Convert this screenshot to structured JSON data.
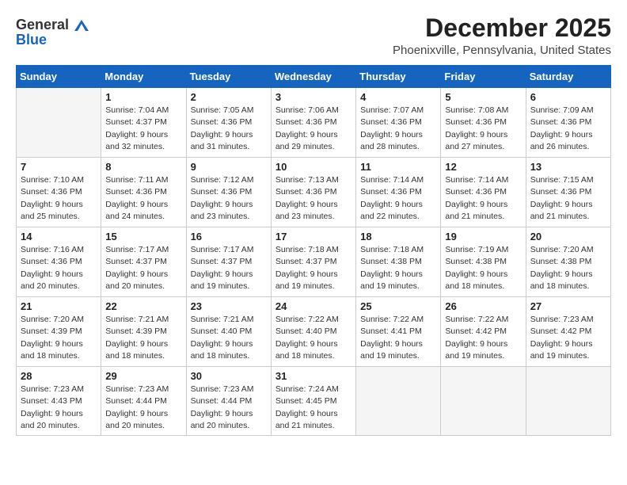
{
  "header": {
    "logo_line1": "General",
    "logo_line2": "Blue",
    "title": "December 2025",
    "subtitle": "Phoenixville, Pennsylvania, United States"
  },
  "days_of_week": [
    "Sunday",
    "Monday",
    "Tuesday",
    "Wednesday",
    "Thursday",
    "Friday",
    "Saturday"
  ],
  "weeks": [
    [
      {
        "day": "",
        "sunrise": "",
        "sunset": "",
        "daylight": ""
      },
      {
        "day": "1",
        "sunrise": "Sunrise: 7:04 AM",
        "sunset": "Sunset: 4:37 PM",
        "daylight": "Daylight: 9 hours and 32 minutes."
      },
      {
        "day": "2",
        "sunrise": "Sunrise: 7:05 AM",
        "sunset": "Sunset: 4:36 PM",
        "daylight": "Daylight: 9 hours and 31 minutes."
      },
      {
        "day": "3",
        "sunrise": "Sunrise: 7:06 AM",
        "sunset": "Sunset: 4:36 PM",
        "daylight": "Daylight: 9 hours and 29 minutes."
      },
      {
        "day": "4",
        "sunrise": "Sunrise: 7:07 AM",
        "sunset": "Sunset: 4:36 PM",
        "daylight": "Daylight: 9 hours and 28 minutes."
      },
      {
        "day": "5",
        "sunrise": "Sunrise: 7:08 AM",
        "sunset": "Sunset: 4:36 PM",
        "daylight": "Daylight: 9 hours and 27 minutes."
      },
      {
        "day": "6",
        "sunrise": "Sunrise: 7:09 AM",
        "sunset": "Sunset: 4:36 PM",
        "daylight": "Daylight: 9 hours and 26 minutes."
      }
    ],
    [
      {
        "day": "7",
        "sunrise": "Sunrise: 7:10 AM",
        "sunset": "Sunset: 4:36 PM",
        "daylight": "Daylight: 9 hours and 25 minutes."
      },
      {
        "day": "8",
        "sunrise": "Sunrise: 7:11 AM",
        "sunset": "Sunset: 4:36 PM",
        "daylight": "Daylight: 9 hours and 24 minutes."
      },
      {
        "day": "9",
        "sunrise": "Sunrise: 7:12 AM",
        "sunset": "Sunset: 4:36 PM",
        "daylight": "Daylight: 9 hours and 23 minutes."
      },
      {
        "day": "10",
        "sunrise": "Sunrise: 7:13 AM",
        "sunset": "Sunset: 4:36 PM",
        "daylight": "Daylight: 9 hours and 23 minutes."
      },
      {
        "day": "11",
        "sunrise": "Sunrise: 7:14 AM",
        "sunset": "Sunset: 4:36 PM",
        "daylight": "Daylight: 9 hours and 22 minutes."
      },
      {
        "day": "12",
        "sunrise": "Sunrise: 7:14 AM",
        "sunset": "Sunset: 4:36 PM",
        "daylight": "Daylight: 9 hours and 21 minutes."
      },
      {
        "day": "13",
        "sunrise": "Sunrise: 7:15 AM",
        "sunset": "Sunset: 4:36 PM",
        "daylight": "Daylight: 9 hours and 21 minutes."
      }
    ],
    [
      {
        "day": "14",
        "sunrise": "Sunrise: 7:16 AM",
        "sunset": "Sunset: 4:36 PM",
        "daylight": "Daylight: 9 hours and 20 minutes."
      },
      {
        "day": "15",
        "sunrise": "Sunrise: 7:17 AM",
        "sunset": "Sunset: 4:37 PM",
        "daylight": "Daylight: 9 hours and 20 minutes."
      },
      {
        "day": "16",
        "sunrise": "Sunrise: 7:17 AM",
        "sunset": "Sunset: 4:37 PM",
        "daylight": "Daylight: 9 hours and 19 minutes."
      },
      {
        "day": "17",
        "sunrise": "Sunrise: 7:18 AM",
        "sunset": "Sunset: 4:37 PM",
        "daylight": "Daylight: 9 hours and 19 minutes."
      },
      {
        "day": "18",
        "sunrise": "Sunrise: 7:18 AM",
        "sunset": "Sunset: 4:38 PM",
        "daylight": "Daylight: 9 hours and 19 minutes."
      },
      {
        "day": "19",
        "sunrise": "Sunrise: 7:19 AM",
        "sunset": "Sunset: 4:38 PM",
        "daylight": "Daylight: 9 hours and 18 minutes."
      },
      {
        "day": "20",
        "sunrise": "Sunrise: 7:20 AM",
        "sunset": "Sunset: 4:38 PM",
        "daylight": "Daylight: 9 hours and 18 minutes."
      }
    ],
    [
      {
        "day": "21",
        "sunrise": "Sunrise: 7:20 AM",
        "sunset": "Sunset: 4:39 PM",
        "daylight": "Daylight: 9 hours and 18 minutes."
      },
      {
        "day": "22",
        "sunrise": "Sunrise: 7:21 AM",
        "sunset": "Sunset: 4:39 PM",
        "daylight": "Daylight: 9 hours and 18 minutes."
      },
      {
        "day": "23",
        "sunrise": "Sunrise: 7:21 AM",
        "sunset": "Sunset: 4:40 PM",
        "daylight": "Daylight: 9 hours and 18 minutes."
      },
      {
        "day": "24",
        "sunrise": "Sunrise: 7:22 AM",
        "sunset": "Sunset: 4:40 PM",
        "daylight": "Daylight: 9 hours and 18 minutes."
      },
      {
        "day": "25",
        "sunrise": "Sunrise: 7:22 AM",
        "sunset": "Sunset: 4:41 PM",
        "daylight": "Daylight: 9 hours and 19 minutes."
      },
      {
        "day": "26",
        "sunrise": "Sunrise: 7:22 AM",
        "sunset": "Sunset: 4:42 PM",
        "daylight": "Daylight: 9 hours and 19 minutes."
      },
      {
        "day": "27",
        "sunrise": "Sunrise: 7:23 AM",
        "sunset": "Sunset: 4:42 PM",
        "daylight": "Daylight: 9 hours and 19 minutes."
      }
    ],
    [
      {
        "day": "28",
        "sunrise": "Sunrise: 7:23 AM",
        "sunset": "Sunset: 4:43 PM",
        "daylight": "Daylight: 9 hours and 20 minutes."
      },
      {
        "day": "29",
        "sunrise": "Sunrise: 7:23 AM",
        "sunset": "Sunset: 4:44 PM",
        "daylight": "Daylight: 9 hours and 20 minutes."
      },
      {
        "day": "30",
        "sunrise": "Sunrise: 7:23 AM",
        "sunset": "Sunset: 4:44 PM",
        "daylight": "Daylight: 9 hours and 20 minutes."
      },
      {
        "day": "31",
        "sunrise": "Sunrise: 7:24 AM",
        "sunset": "Sunset: 4:45 PM",
        "daylight": "Daylight: 9 hours and 21 minutes."
      },
      {
        "day": "",
        "sunrise": "",
        "sunset": "",
        "daylight": ""
      },
      {
        "day": "",
        "sunrise": "",
        "sunset": "",
        "daylight": ""
      },
      {
        "day": "",
        "sunrise": "",
        "sunset": "",
        "daylight": ""
      }
    ]
  ]
}
